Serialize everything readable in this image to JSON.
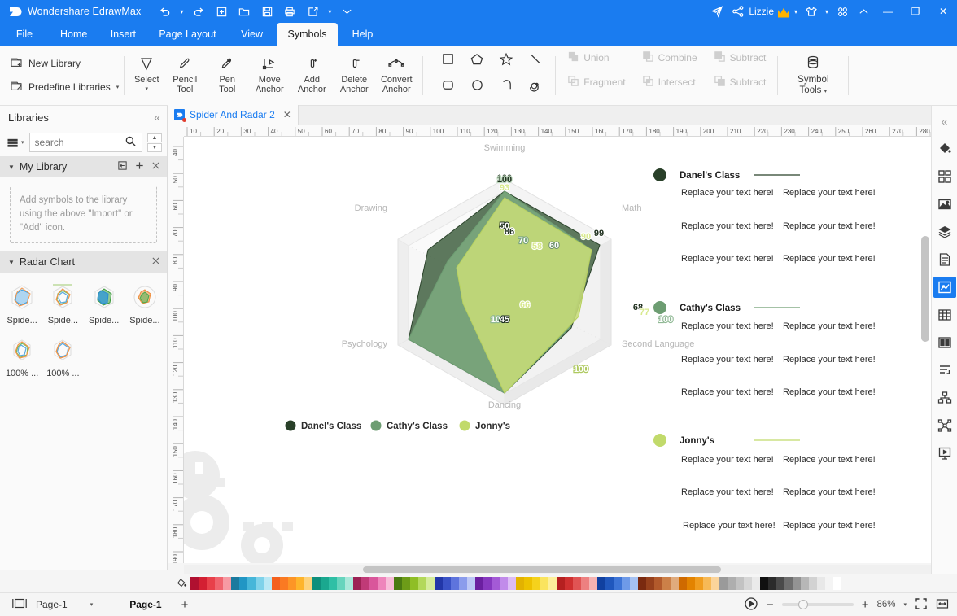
{
  "titlebar": {
    "app_title": "Wondershare EdrawMax",
    "logo_icon": "edraw-logo-icon",
    "quick_access": [
      {
        "name": "undo-icon",
        "glyph": "↶",
        "has_caret": true
      },
      {
        "name": "redo-icon",
        "glyph": "↷",
        "has_caret": false
      },
      {
        "name": "new-icon",
        "glyph": "⊞",
        "has_caret": false
      },
      {
        "name": "open-icon",
        "glyph": "὜1",
        "has_caret": false
      },
      {
        "name": "save-icon",
        "glyph": "὚b",
        "has_caret": false
      },
      {
        "name": "print-icon",
        "glyph": "⎙",
        "has_caret": false
      },
      {
        "name": "export-icon",
        "glyph": "↗",
        "has_caret": true
      },
      {
        "name": "customize-qat-icon",
        "glyph": "⌄",
        "has_caret": false
      }
    ],
    "right_icons": [
      {
        "name": "send-icon",
        "glyph": "➤"
      },
      {
        "name": "share-icon",
        "glyph": "⁂"
      }
    ],
    "user_name": "Lizzie",
    "user_badge": "crown-icon",
    "theme_icon": "tshirt-icon",
    "grid_icon": "apps-grid-icon",
    "collapse_ribbon_icon": "chevron-up-icon",
    "window_buttons": [
      {
        "name": "minimize-button",
        "glyph": "—"
      },
      {
        "name": "maximize-button",
        "glyph": "❐"
      },
      {
        "name": "close-button",
        "glyph": "✕"
      }
    ]
  },
  "menubar": {
    "items": [
      {
        "label": "File",
        "active": false
      },
      {
        "label": "Home",
        "active": false
      },
      {
        "label": "Insert",
        "active": false
      },
      {
        "label": "Page Layout",
        "active": false
      },
      {
        "label": "View",
        "active": false
      },
      {
        "label": "Symbols",
        "active": true
      },
      {
        "label": "Help",
        "active": false
      }
    ]
  },
  "ribbon": {
    "library_buttons": [
      {
        "label": "New Library",
        "icon": "new-library-icon",
        "caret": false
      },
      {
        "label": "Predefine Libraries",
        "icon": "predefine-libraries-icon",
        "caret": true
      }
    ],
    "tools": [
      {
        "label_line1": "Select",
        "label_line2": "",
        "icon": "cursor-arrow-icon",
        "caret": true
      },
      {
        "label_line1": "Pencil",
        "label_line2": "Tool",
        "icon": "pencil-icon",
        "caret": false
      },
      {
        "label_line1": "Pen",
        "label_line2": "Tool",
        "icon": "pen-icon",
        "caret": false
      },
      {
        "label_line1": "Move",
        "label_line2": "Anchor",
        "icon": "move-anchor-icon",
        "caret": false
      },
      {
        "label_line1": "Add",
        "label_line2": "Anchor",
        "icon": "add-anchor-icon",
        "caret": false
      },
      {
        "label_line1": "Delete",
        "label_line2": "Anchor",
        "icon": "delete-anchor-icon",
        "caret": false
      },
      {
        "label_line1": "Convert",
        "label_line2": "Anchor",
        "icon": "convert-anchor-icon",
        "caret": false
      }
    ],
    "shapes": [
      {
        "name": "square-shape-icon"
      },
      {
        "name": "pentagon-shape-icon"
      },
      {
        "name": "star-shape-icon"
      },
      {
        "name": "line-shape-icon"
      },
      {
        "name": "rounded-rect-shape-icon"
      },
      {
        "name": "circle-shape-icon"
      },
      {
        "name": "arc-shape-icon"
      },
      {
        "name": "spiral-shape-icon"
      }
    ],
    "boolean_ops": [
      {
        "label": "Union",
        "icon": "union-icon",
        "disabled": true
      },
      {
        "label": "Combine",
        "icon": "combine-icon",
        "disabled": true
      },
      {
        "label": "Subtract",
        "icon": "subtract-front-icon",
        "disabled": true
      },
      {
        "label": "Fragment",
        "icon": "fragment-icon",
        "disabled": true
      },
      {
        "label": "Intersect",
        "icon": "intersect-icon",
        "disabled": true
      },
      {
        "label": "Subtract",
        "icon": "subtract-back-icon",
        "disabled": true
      }
    ],
    "symbol_tools": {
      "line1": "Symbol",
      "line2": "Tools",
      "icon": "symbol-tools-icon",
      "caret": true
    }
  },
  "left_panel": {
    "title": "Libraries",
    "collapse_icon": "chevron-double-left-icon",
    "search": {
      "placeholder": "search",
      "value": "",
      "icon": "search-icon",
      "dropdown_icon": "library-dropdown-icon"
    },
    "spinner": {
      "up_icon": "chevron-up-icon",
      "down_icon": "chevron-down-icon"
    },
    "sections": [
      {
        "title": "My Library",
        "expanded": true,
        "actions": [
          "import-icon",
          "add-icon",
          "close-icon"
        ],
        "empty_text": "Add symbols to the library using the above \"Import\" or \"Add\" icon."
      },
      {
        "title": "Radar Chart",
        "expanded": true,
        "actions": [
          "close-icon"
        ],
        "items": [
          {
            "label": "Spide..."
          },
          {
            "label": "Spide..."
          },
          {
            "label": "Spide..."
          },
          {
            "label": "Spide..."
          },
          {
            "label": "100% ..."
          },
          {
            "label": "100% ..."
          }
        ]
      }
    ]
  },
  "document": {
    "tab_label": "Spider And Radar 2",
    "tab_icon": "document-icon",
    "close_icon": "close-icon",
    "ruler_h_ticks": [
      10,
      20,
      30,
      40,
      50,
      60,
      70,
      80,
      90,
      100,
      110,
      120,
      130,
      140,
      150,
      160,
      170,
      180,
      190,
      200,
      210,
      220,
      230,
      240,
      250,
      260,
      270,
      280
    ],
    "ruler_v_ticks": [
      40,
      50,
      60,
      70,
      80,
      90,
      100,
      110,
      120,
      130,
      140,
      150,
      160,
      170,
      180,
      190
    ]
  },
  "right_rail": {
    "collapse_icon": "chevron-double-left-icon",
    "icons": [
      {
        "name": "fill-style-icon",
        "active": false
      },
      {
        "name": "quick-styles-icon",
        "active": false
      },
      {
        "name": "picture-icon",
        "active": false
      },
      {
        "name": "layers-icon",
        "active": false
      },
      {
        "name": "notes-icon",
        "active": false
      },
      {
        "name": "chart-icon",
        "active": true
      },
      {
        "name": "table-icon",
        "active": false
      },
      {
        "name": "infographic-icon",
        "active": false
      },
      {
        "name": "outline-icon",
        "active": false
      },
      {
        "name": "org-chart-icon",
        "active": false
      },
      {
        "name": "mindmap-icon",
        "active": false
      },
      {
        "name": "presentation-icon",
        "active": false
      }
    ]
  },
  "statusbar": {
    "view_icon": "page-view-icon",
    "page_selector": "Page-1",
    "page_selector_caret_icon": "chevron-down-icon",
    "page_tab": "Page-1",
    "add_page_icon": "plus-icon",
    "play_icon": "presentation-play-icon",
    "zoom_out_icon": "minus-icon",
    "zoom_in_icon": "plus-icon",
    "zoom_level": "86%",
    "zoom_caret_icon": "chevron-down-icon",
    "fit_page_icon": "fit-page-icon",
    "fit_width_icon": "fit-width-icon"
  },
  "palette": {
    "fill_icon": "paint-bucket-icon",
    "colors": [
      "#b01030",
      "#d31f32",
      "#e8404a",
      "#f0646e",
      "#f79aa3",
      "#1b7a9e",
      "#2196c4",
      "#46b6d9",
      "#7fd2ea",
      "#b9e8f5",
      "#f4601d",
      "#fa7a22",
      "#fd9526",
      "#feb42b",
      "#fed27a",
      "#0f8f7c",
      "#1aa88f",
      "#2fbfa5",
      "#66d4bd",
      "#a9e8da",
      "#9c2254",
      "#c03a77",
      "#d9569b",
      "#ee84bb",
      "#f8bcd9",
      "#4a7a12",
      "#6d9c18",
      "#8fbe26",
      "#b3d85a",
      "#d5ec9a",
      "#2237a8",
      "#3a52c6",
      "#5e74dd",
      "#8b9cec",
      "#bcc7f6",
      "#6b1fa0",
      "#8738bf",
      "#a45ad6",
      "#c18bea",
      "#ddbcf6",
      "#e3b200",
      "#edc100",
      "#f5d21c",
      "#fae45e",
      "#fdf09b",
      "#b52020",
      "#cf3030",
      "#e05454",
      "#ed8080",
      "#f5b2b2",
      "#1040a0",
      "#2057bd",
      "#3d74d6",
      "#6e9ae8",
      "#a6c2f3",
      "#7a2a10",
      "#96401c",
      "#b25a2c",
      "#cc8048",
      "#e0ab7d",
      "#cf6a00",
      "#e38300",
      "#f09c1e",
      "#f7b956",
      "#fbd49a",
      "#9a9a9a",
      "#aeaeae",
      "#c2c2c2",
      "#d6d6d6",
      "#eaeaea",
      "#101010",
      "#2b2b2b",
      "#4a4a4a",
      "#6e6e6e",
      "#939393",
      "#b7b7b7",
      "#d2d2d2",
      "#e8e8e8",
      "#f4f4f4",
      "#ffffff"
    ]
  },
  "chart_data": {
    "type": "radar",
    "title": "",
    "categories": [
      "Swimming",
      "Math",
      "Second Language",
      "Dancing",
      "Psychology",
      "Drawing"
    ],
    "max": 100,
    "series": [
      {
        "name": "Danel's Class",
        "color": "#294029",
        "values": [
          100,
          99,
          68,
          100,
          100,
          86
        ]
      },
      {
        "name": "Cathy's Class",
        "color": "#6d9d72",
        "values": [
          100,
          90,
          66,
          100,
          100,
          70
        ]
      },
      {
        "name": "Jonny's",
        "color": "#c1da6b",
        "values": [
          93,
          90,
          77,
          100,
          66,
          58
        ]
      }
    ],
    "inner_labels": [
      {
        "text": "50",
        "axis": "Swimming"
      },
      {
        "text": "60",
        "axis": "Math"
      },
      {
        "text": "45",
        "axis": "Dancing"
      }
    ],
    "legend": [
      "Danel's Class",
      "Cathy's Class",
      "Jonny's"
    ],
    "legend_position": "bottom"
  },
  "notes": {
    "placeholder_text": "Replace your text here!",
    "blocks": [
      {
        "title": "Danel's Class",
        "color": "#294029",
        "rows": [
          [
            "Replace your text here!",
            "Replace your text here!"
          ],
          [
            "Replace your text here!",
            "Replace your text here!"
          ],
          [
            "Replace your text here!",
            "Replace your text here!"
          ]
        ]
      },
      {
        "title": "Cathy's Class",
        "color": "#6d9d72",
        "rows": [
          [
            "Replace your text here!",
            "Replace your text here!"
          ],
          [
            "Replace your text here!",
            "Replace your text here!"
          ],
          [
            "Replace your text here!",
            "Replace your text here!"
          ]
        ]
      },
      {
        "title": "Jonny's",
        "color": "#c1da6b",
        "rows": [
          [
            "Replace your text here!",
            "Replace your text here!"
          ],
          [
            "Replace your text here!",
            "Replace your text here!"
          ],
          [
            "Replace your text here!",
            "Replace your text here!"
          ]
        ]
      }
    ]
  }
}
